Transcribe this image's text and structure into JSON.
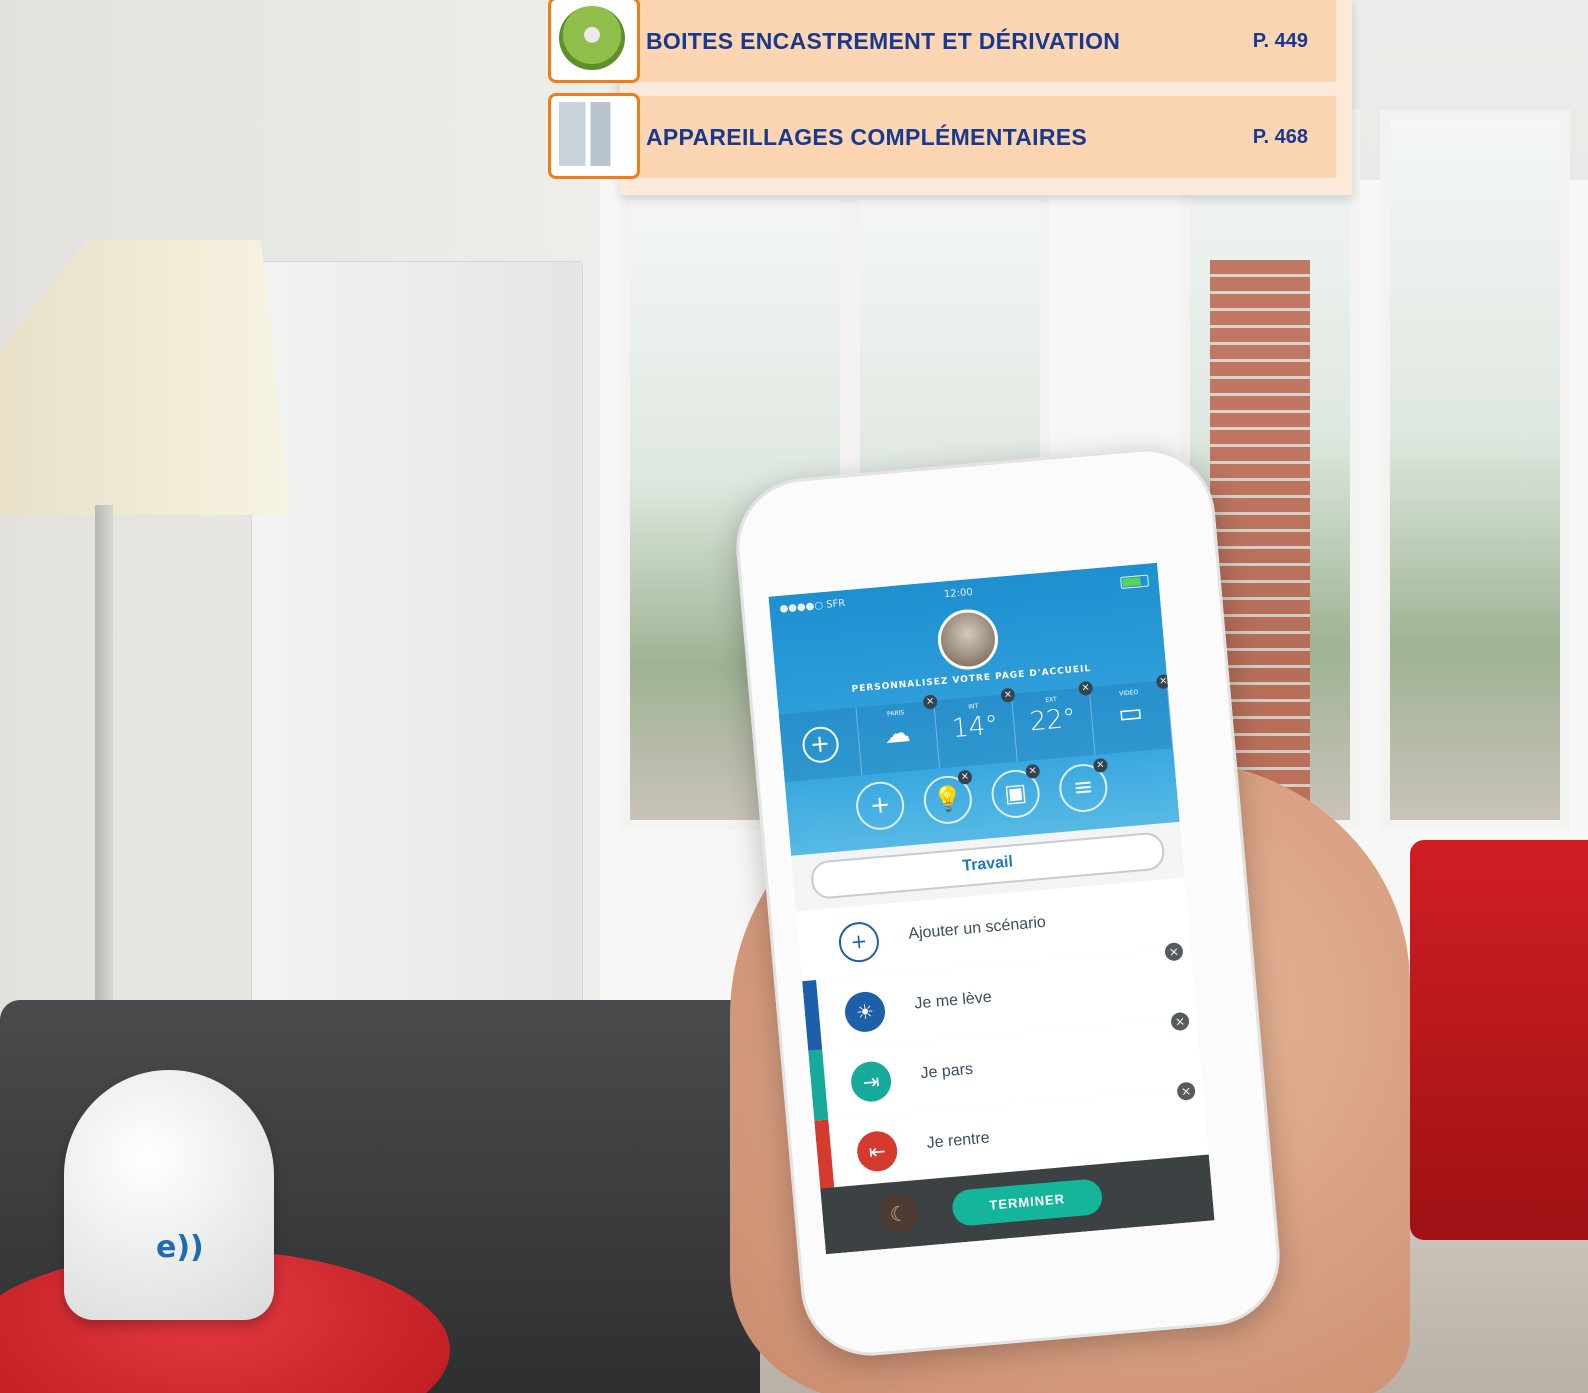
{
  "catalog_index": {
    "items": [
      {
        "title": "BOITES ENCASTREMENT ET DÉRIVATION",
        "page": "P. 449",
        "thumb_icon": "junction-box-icon"
      },
      {
        "title": "APPAREILLAGES COMPLÉMENTAIRES",
        "page": "P. 468",
        "thumb_icon": "electrical-accessories-icon"
      }
    ],
    "colors": {
      "row_bg": "#fcd5b3",
      "text": "#173a8f",
      "thumb_border": "#ef7d1a"
    }
  },
  "phone_app": {
    "status_bar": {
      "carrier": "●●●●○ SFR",
      "time": "12:00"
    },
    "home_title": "PERSONNALISEZ VOTRE PAGE D'ACCUEIL",
    "widgets": [
      {
        "caption": "",
        "value": "",
        "icon": "plus-icon"
      },
      {
        "caption": "PARIS",
        "value": "",
        "icon": "weather-icon"
      },
      {
        "caption": "INT",
        "value": "14°",
        "icon": ""
      },
      {
        "caption": "EXT",
        "value": "22°",
        "icon": ""
      },
      {
        "caption": "VIDÉO",
        "value": "",
        "icon": "camera-icon"
      }
    ],
    "shortcut_icons": [
      "plus-icon",
      "bulb-icon",
      "socket-icon",
      "shutter-icon"
    ],
    "profile_tab": "Travail",
    "add_scenario": "Ajouter un scénario",
    "scenarios": [
      {
        "label": "Je me lève",
        "icon": "sun-icon",
        "color": "#1d5fa8"
      },
      {
        "label": "Je pars",
        "icon": "door-exit-icon",
        "color": "#17a99a"
      },
      {
        "label": "Je rentre",
        "icon": "door-enter-icon",
        "color": "#d53a2f"
      }
    ],
    "finish_button": "TERMINER",
    "accent": "#15b59b"
  },
  "device_logo": "e))"
}
